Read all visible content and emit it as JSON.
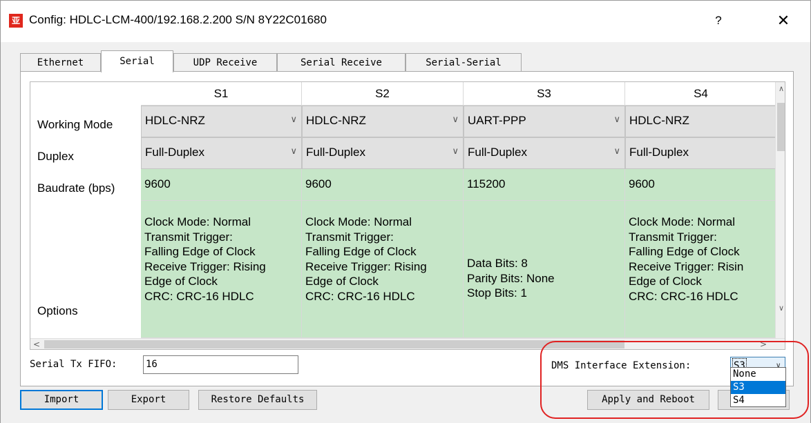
{
  "window": {
    "app_icon_glyph": "亚",
    "title": "Config: HDLC-LCM-400/192.168.2.200  S/N 8Y22C01680",
    "help_glyph": "?",
    "close_glyph": "✕"
  },
  "tabs": [
    {
      "label": "Ethernet",
      "active": false
    },
    {
      "label": "Serial",
      "active": true
    },
    {
      "label": "UDP Receive",
      "active": false
    },
    {
      "label": "Serial Receive",
      "active": false
    },
    {
      "label": "Serial-Serial",
      "active": false
    }
  ],
  "table": {
    "row_labels": {
      "working_mode": "Working Mode",
      "duplex": "Duplex",
      "baudrate": "Baudrate (bps)",
      "options": "Options"
    },
    "columns": [
      {
        "header": "S1",
        "working_mode": "HDLC-NRZ",
        "duplex": "Full-Duplex",
        "baudrate": "9600",
        "options": "Clock Mode: Normal\nTransmit Trigger:\nFalling Edge of Clock\nReceive Trigger: Rising\nEdge of Clock\nCRC: CRC-16 HDLC"
      },
      {
        "header": "S2",
        "working_mode": "HDLC-NRZ",
        "duplex": "Full-Duplex",
        "baudrate": "9600",
        "options": "Clock Mode: Normal\nTransmit Trigger:\nFalling Edge of Clock\nReceive Trigger: Rising\nEdge of Clock\nCRC: CRC-16 HDLC"
      },
      {
        "header": "S3",
        "working_mode": "UART-PPP",
        "duplex": "Full-Duplex",
        "baudrate": "115200",
        "options": "Data Bits: 8\nParity Bits: None\nStop Bits: 1"
      },
      {
        "header": "S4",
        "working_mode": "HDLC-NRZ",
        "duplex": "Full-Duplex",
        "baudrate": "9600",
        "options": "Clock Mode: Normal\nTransmit Trigger:\nFalling Edge of Clock\nReceive Trigger: Risin\nEdge of Clock\nCRC: CRC-16 HDLC"
      }
    ],
    "dropdown_arrow_glyph": "∨",
    "cell_color_green": "#c6e6c8",
    "cell_color_combo": "#e1e1e1"
  },
  "scrollbars": {
    "up_glyph": "∧",
    "down_glyph": "∨",
    "left_glyph": "<",
    "right_glyph": ">"
  },
  "fifo": {
    "label": "Serial Tx FIFO:",
    "value": "16"
  },
  "dms": {
    "label": "DMS Interface Extension:",
    "value": "S3",
    "arrow_glyph": "∨",
    "options": [
      "None",
      "S3",
      "S4"
    ],
    "selected_option": "S3"
  },
  "buttons": {
    "import": "Import",
    "export": "Export",
    "restore_defaults": "Restore Defaults",
    "apply_and_reboot": "Apply and Reboot"
  },
  "colors": {
    "accent": "#0078d7",
    "annotation_red": "#e02222",
    "app_icon_red": "#e0271d"
  }
}
